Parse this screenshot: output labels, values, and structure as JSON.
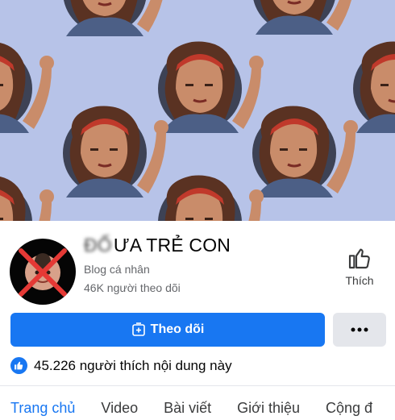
{
  "page": {
    "name_hidden": "ĐỐ",
    "name": "ƯA TRẺ CON",
    "category": "Blog cá nhân",
    "followers": "46K người theo dõi"
  },
  "like_side": {
    "label": "Thích",
    "icon": "thumbs-up-outline-icon"
  },
  "follow_button": {
    "label": "Theo dõi",
    "icon": "follow-plus-icon"
  },
  "more_button": {
    "icon": "more-dots-icon"
  },
  "likes": {
    "text": "45.226 người thích nội dung này",
    "icon": "like-badge-icon"
  },
  "tabs": [
    {
      "label": "Trang chủ",
      "active": true
    },
    {
      "label": "Video",
      "active": false
    },
    {
      "label": "Bài viết",
      "active": false
    },
    {
      "label": "Giới thiệu",
      "active": false
    },
    {
      "label": "Cộng đ",
      "active": false
    }
  ],
  "colors": {
    "accent": "#1877f2",
    "cover_bg": "#b7c3e8",
    "button_grey": "#e4e6eb"
  }
}
